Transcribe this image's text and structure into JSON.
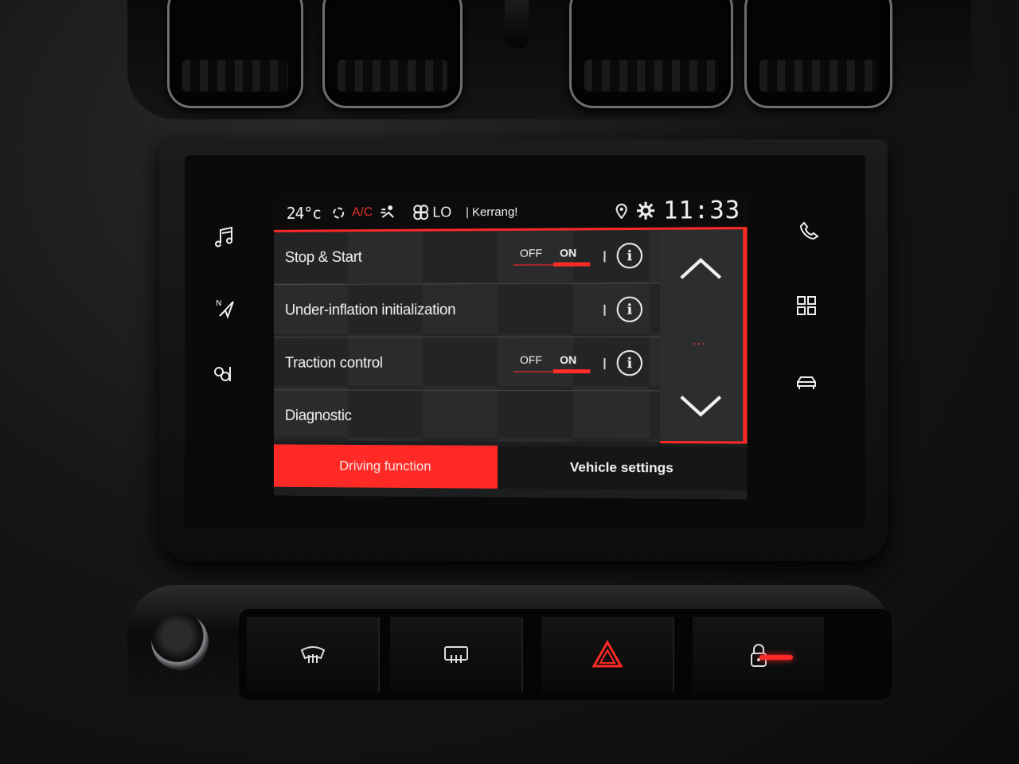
{
  "status_bar": {
    "temperature": "24°c",
    "ac_label": "A/C",
    "fan_level": "LO",
    "station": "| Kerrang!",
    "time": "11:33"
  },
  "settings": [
    {
      "label": "Stop & Start",
      "has_toggle": true,
      "off_label": "OFF",
      "on_label": "ON",
      "state": "ON"
    },
    {
      "label": "Under-inflation initialization",
      "has_toggle": false
    },
    {
      "label": "Traction control",
      "has_toggle": true,
      "off_label": "OFF",
      "on_label": "ON",
      "state": "ON"
    },
    {
      "label": "Diagnostic",
      "has_toggle": false
    }
  ],
  "scroll": {
    "dots": "..."
  },
  "tabs": [
    {
      "label": "Driving function",
      "active": true
    },
    {
      "label": "Vehicle settings",
      "active": false
    }
  ],
  "side_keys_left": [
    "music-icon",
    "navigation-icon",
    "climate-icon"
  ],
  "side_keys_right": [
    "phone-icon",
    "apps-grid-icon",
    "car-icon"
  ],
  "console_buttons": [
    "windscreen-demist-icon",
    "rear-demist-icon",
    "hazard-icon",
    "lock-icon"
  ],
  "colors": {
    "accent": "#ff2a26",
    "text": "#f3f3f3",
    "screen_bg": "#1d1e20"
  }
}
